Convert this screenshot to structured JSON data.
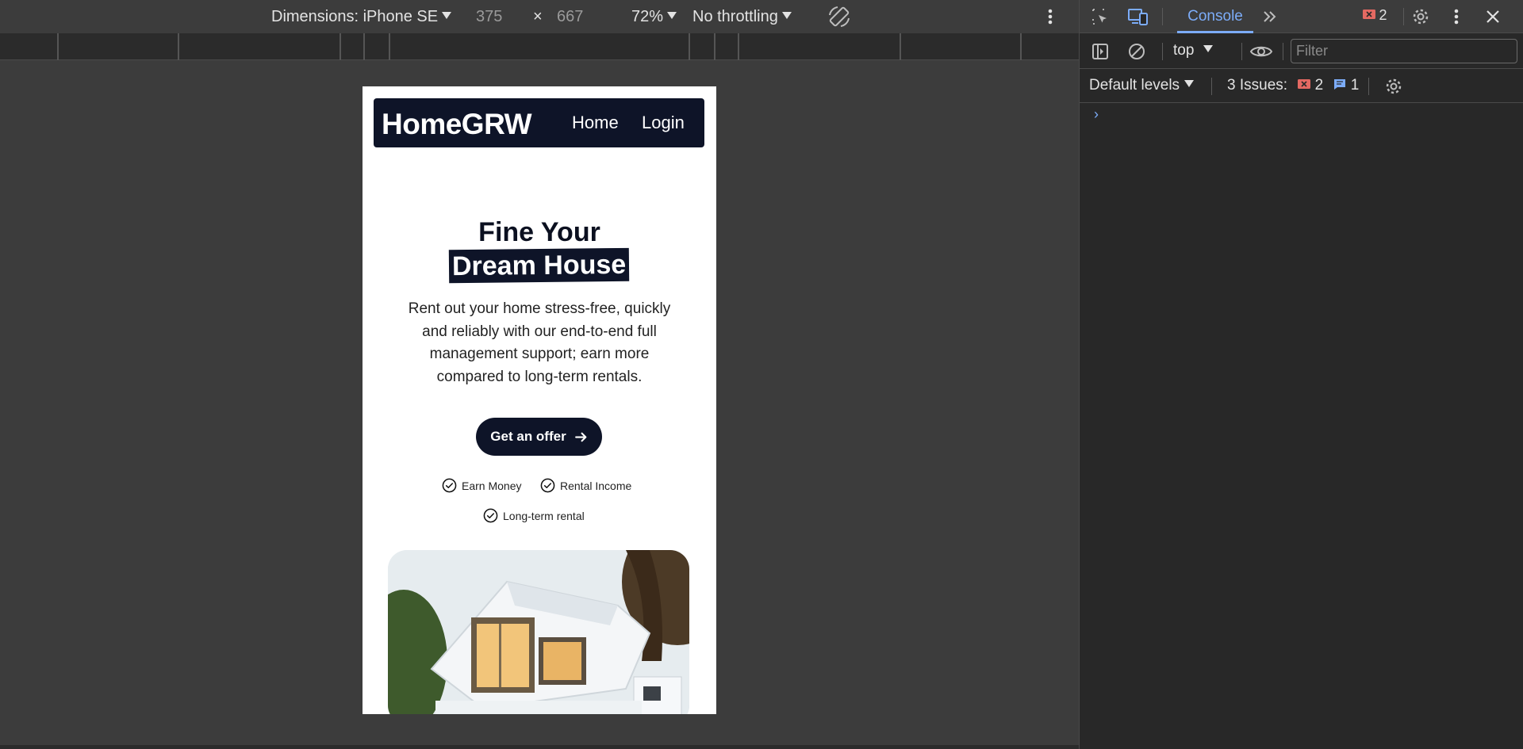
{
  "device_toolbar": {
    "dimensions_label": "Dimensions: iPhone SE",
    "width": "375",
    "times": "×",
    "height": "667",
    "zoom": "72%",
    "throttling": "No throttling"
  },
  "page": {
    "nav": {
      "logo": "HomeGRW",
      "links": [
        "Home",
        "Login"
      ]
    },
    "hero": {
      "title_line1": "Fine Your",
      "title_line2": "Dream House",
      "description": "Rent out your home stress-free, quickly and reliably with our end-to-end full management support; earn more compared to long-term rentals.",
      "cta_label": "Get an offer",
      "features": [
        "Earn Money",
        "Rental Income",
        "Long-term rental"
      ]
    }
  },
  "devtools": {
    "tabs": [
      {
        "label": "Console",
        "active": true
      }
    ],
    "error_count": "2",
    "context": "top",
    "filter_placeholder": "Filter",
    "levels_label": "Default levels",
    "issues_label": "3 Issues:",
    "issues_errors": "2",
    "issues_info": "1",
    "prompt": "›"
  },
  "colors": {
    "navy": "#0e1428",
    "devtools_accent": "#7cacf8",
    "error_red": "#e46962"
  }
}
